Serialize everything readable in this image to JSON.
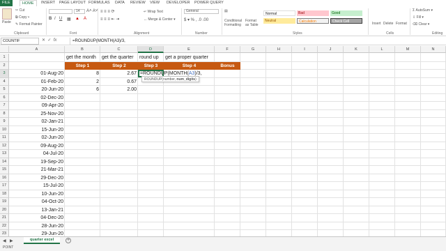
{
  "ribbon_tabs": [
    "FILE",
    "HOME",
    "INSERT",
    "PAGE LAYOUT",
    "FORMULAS",
    "DATA",
    "REVIEW",
    "VIEW",
    "DEVELOPER",
    "POWER QUERY"
  ],
  "active_tab": "HOME",
  "clipboard": {
    "paste": "Paste",
    "cut": "Cut",
    "copy": "Copy ▾",
    "format_painter": "Format Painter",
    "label": "Clipboard"
  },
  "font": {
    "label": "Font",
    "size": "14"
  },
  "alignment": {
    "wrap": "Wrap Text",
    "merge": "Merge & Center ▾",
    "label": "Alignment"
  },
  "number": {
    "format": "General",
    "label": "Number"
  },
  "styles": {
    "conditional": "Conditional Formatting",
    "format_as_table": "Format as Table",
    "normal": "Normal",
    "bad": "Bad",
    "good": "Good",
    "neutral": "Neutral",
    "calculation": "Calculation",
    "check_cell": "Check Cell",
    "label": "Styles"
  },
  "cells_group": {
    "insert": "Insert",
    "delete": "Delete",
    "format": "Format",
    "label": "Cells"
  },
  "editing": {
    "autosum": "AutoSum ▾",
    "fill": "Fill ▾",
    "clear": "Clear ▾",
    "label": "Editing"
  },
  "namebox": "COUNTIF",
  "formula": "=ROUNDUP(MONTH(A3)/3,",
  "columns": [
    "A",
    "B",
    "C",
    "D",
    "E",
    "F",
    "G",
    "H",
    "I",
    "J",
    "K",
    "L",
    "M",
    "N"
  ],
  "row_numbers": [
    "1",
    "2",
    "3",
    "4",
    "5",
    "6",
    "7",
    "8",
    "9",
    "10",
    "11",
    "12",
    "13",
    "14",
    "15",
    "16",
    "17",
    "18",
    "19",
    "20",
    "21",
    "22",
    "23",
    "24",
    "25",
    "26"
  ],
  "row1": {
    "b": "get the month",
    "c": "get the quarter",
    "d": "round up",
    "e": "get a proper quarter"
  },
  "row2": {
    "b": "Step 1",
    "c": "Step 2",
    "d": "Step 3",
    "e": "Step 4",
    "f": "Bonus"
  },
  "dates": [
    "01-Aug-20",
    "01-Feb-20",
    "20-Jun-20",
    "02-Dec-20",
    "09-Apr-20",
    "25-Nov-20",
    "02-Jan-21",
    "15-Jun-20",
    "02-Jun-20",
    "09-Aug-20",
    "04-Jul-20",
    "19-Sep-20",
    "21-Mar-21",
    "29-Dec-20",
    "15-Jul-20",
    "10-Jun-20",
    "04-Oct-20",
    "13-Jan-21",
    "04-Dec-20",
    "28-Jun-20",
    "29-Jun-20",
    "14-Oct-20"
  ],
  "step1": [
    "8",
    "2",
    "6"
  ],
  "step2": [
    "2.67",
    "0.67",
    "2.00"
  ],
  "edit_cell": {
    "prefix": "=ROUNDUP(MONTH(",
    "ref": "A3",
    "suffix": ")/3,"
  },
  "tooltip": {
    "fn": "ROUNDUP(number, ",
    "arg": "num_digits",
    "close": ")"
  },
  "sheet_tab": "quarter excel",
  "add_sheet": "+",
  "status": "POINT",
  "colors": {
    "excel_green": "#217346",
    "header_orange": "#c65911",
    "ref_blue": "#4472c4"
  }
}
